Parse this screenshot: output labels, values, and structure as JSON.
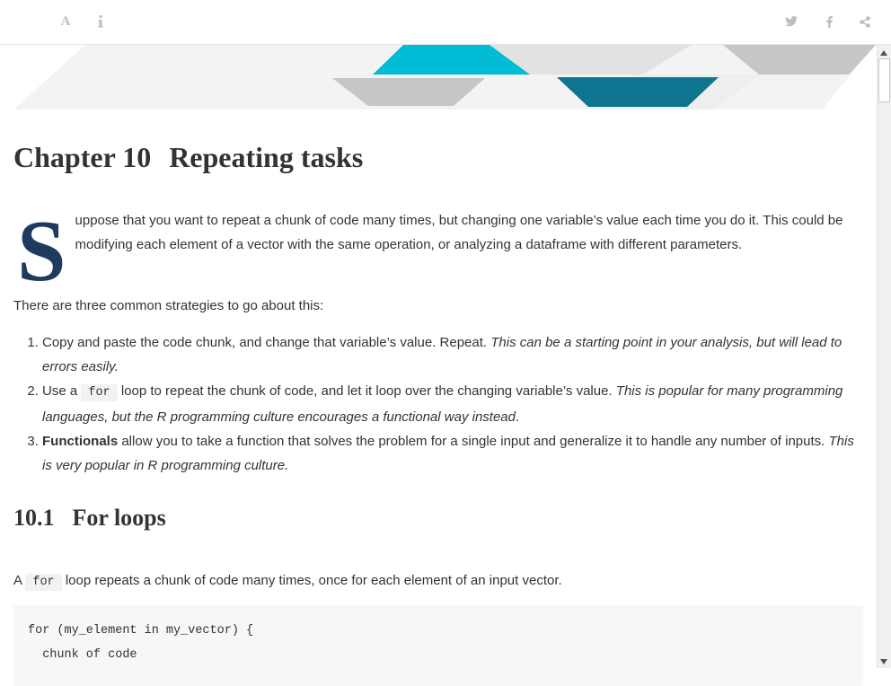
{
  "toolbar": {
    "font_icon_glyph": "A",
    "icons": [
      "font-settings-icon",
      "info-icon",
      "twitter-icon",
      "facebook-icon",
      "share-icon"
    ],
    "icon_color": "#bdbdbd"
  },
  "chapter": {
    "number": "Chapter 10",
    "title": "Repeating tasks"
  },
  "intro": {
    "dropcap": "S",
    "text": "uppose that you want to repeat a chunk of code many times, but changing one variable’s value each time you do it. This could be modifying each element of a vector with the same operation, or analyzing a dataframe with different parameters."
  },
  "strategies_intro": "There are three common strategies to go about this:",
  "strategies": [
    {
      "text": "Copy and paste the code chunk, and change that variable’s value. Repeat. ",
      "emphasis": "This can be a starting point in your analysis, but will lead to errors easily."
    },
    {
      "pre": "Use a ",
      "code": "for",
      "text": " loop to repeat the chunk of code, and let it loop over the changing variable’s value. ",
      "emphasis": "This is popular for many programming languages, but the R programming culture encourages a functional way instead",
      "post": "."
    },
    {
      "strong": "Functionals",
      "text": " allow you to take a function that solves the problem for a single input and generalize it to handle any number of inputs. ",
      "emphasis": "This is very popular in R programming culture."
    }
  ],
  "section": {
    "number": "10.1",
    "title": "For loops"
  },
  "for_para": {
    "pre": "A ",
    "code": "for",
    "post": " loop repeats a chunk of code many times, once for each element of an input vector."
  },
  "code_block": {
    "lines": [
      "for (my_element in my_vector) {",
      "  chunk of code"
    ]
  },
  "colors": {
    "dropcap": "#1e3a5f",
    "banner_cyan": "#00bcd4",
    "banner_teal": "#0e7490",
    "banner_gray": "#cccccc",
    "banner_light": "#e6e6e6"
  }
}
